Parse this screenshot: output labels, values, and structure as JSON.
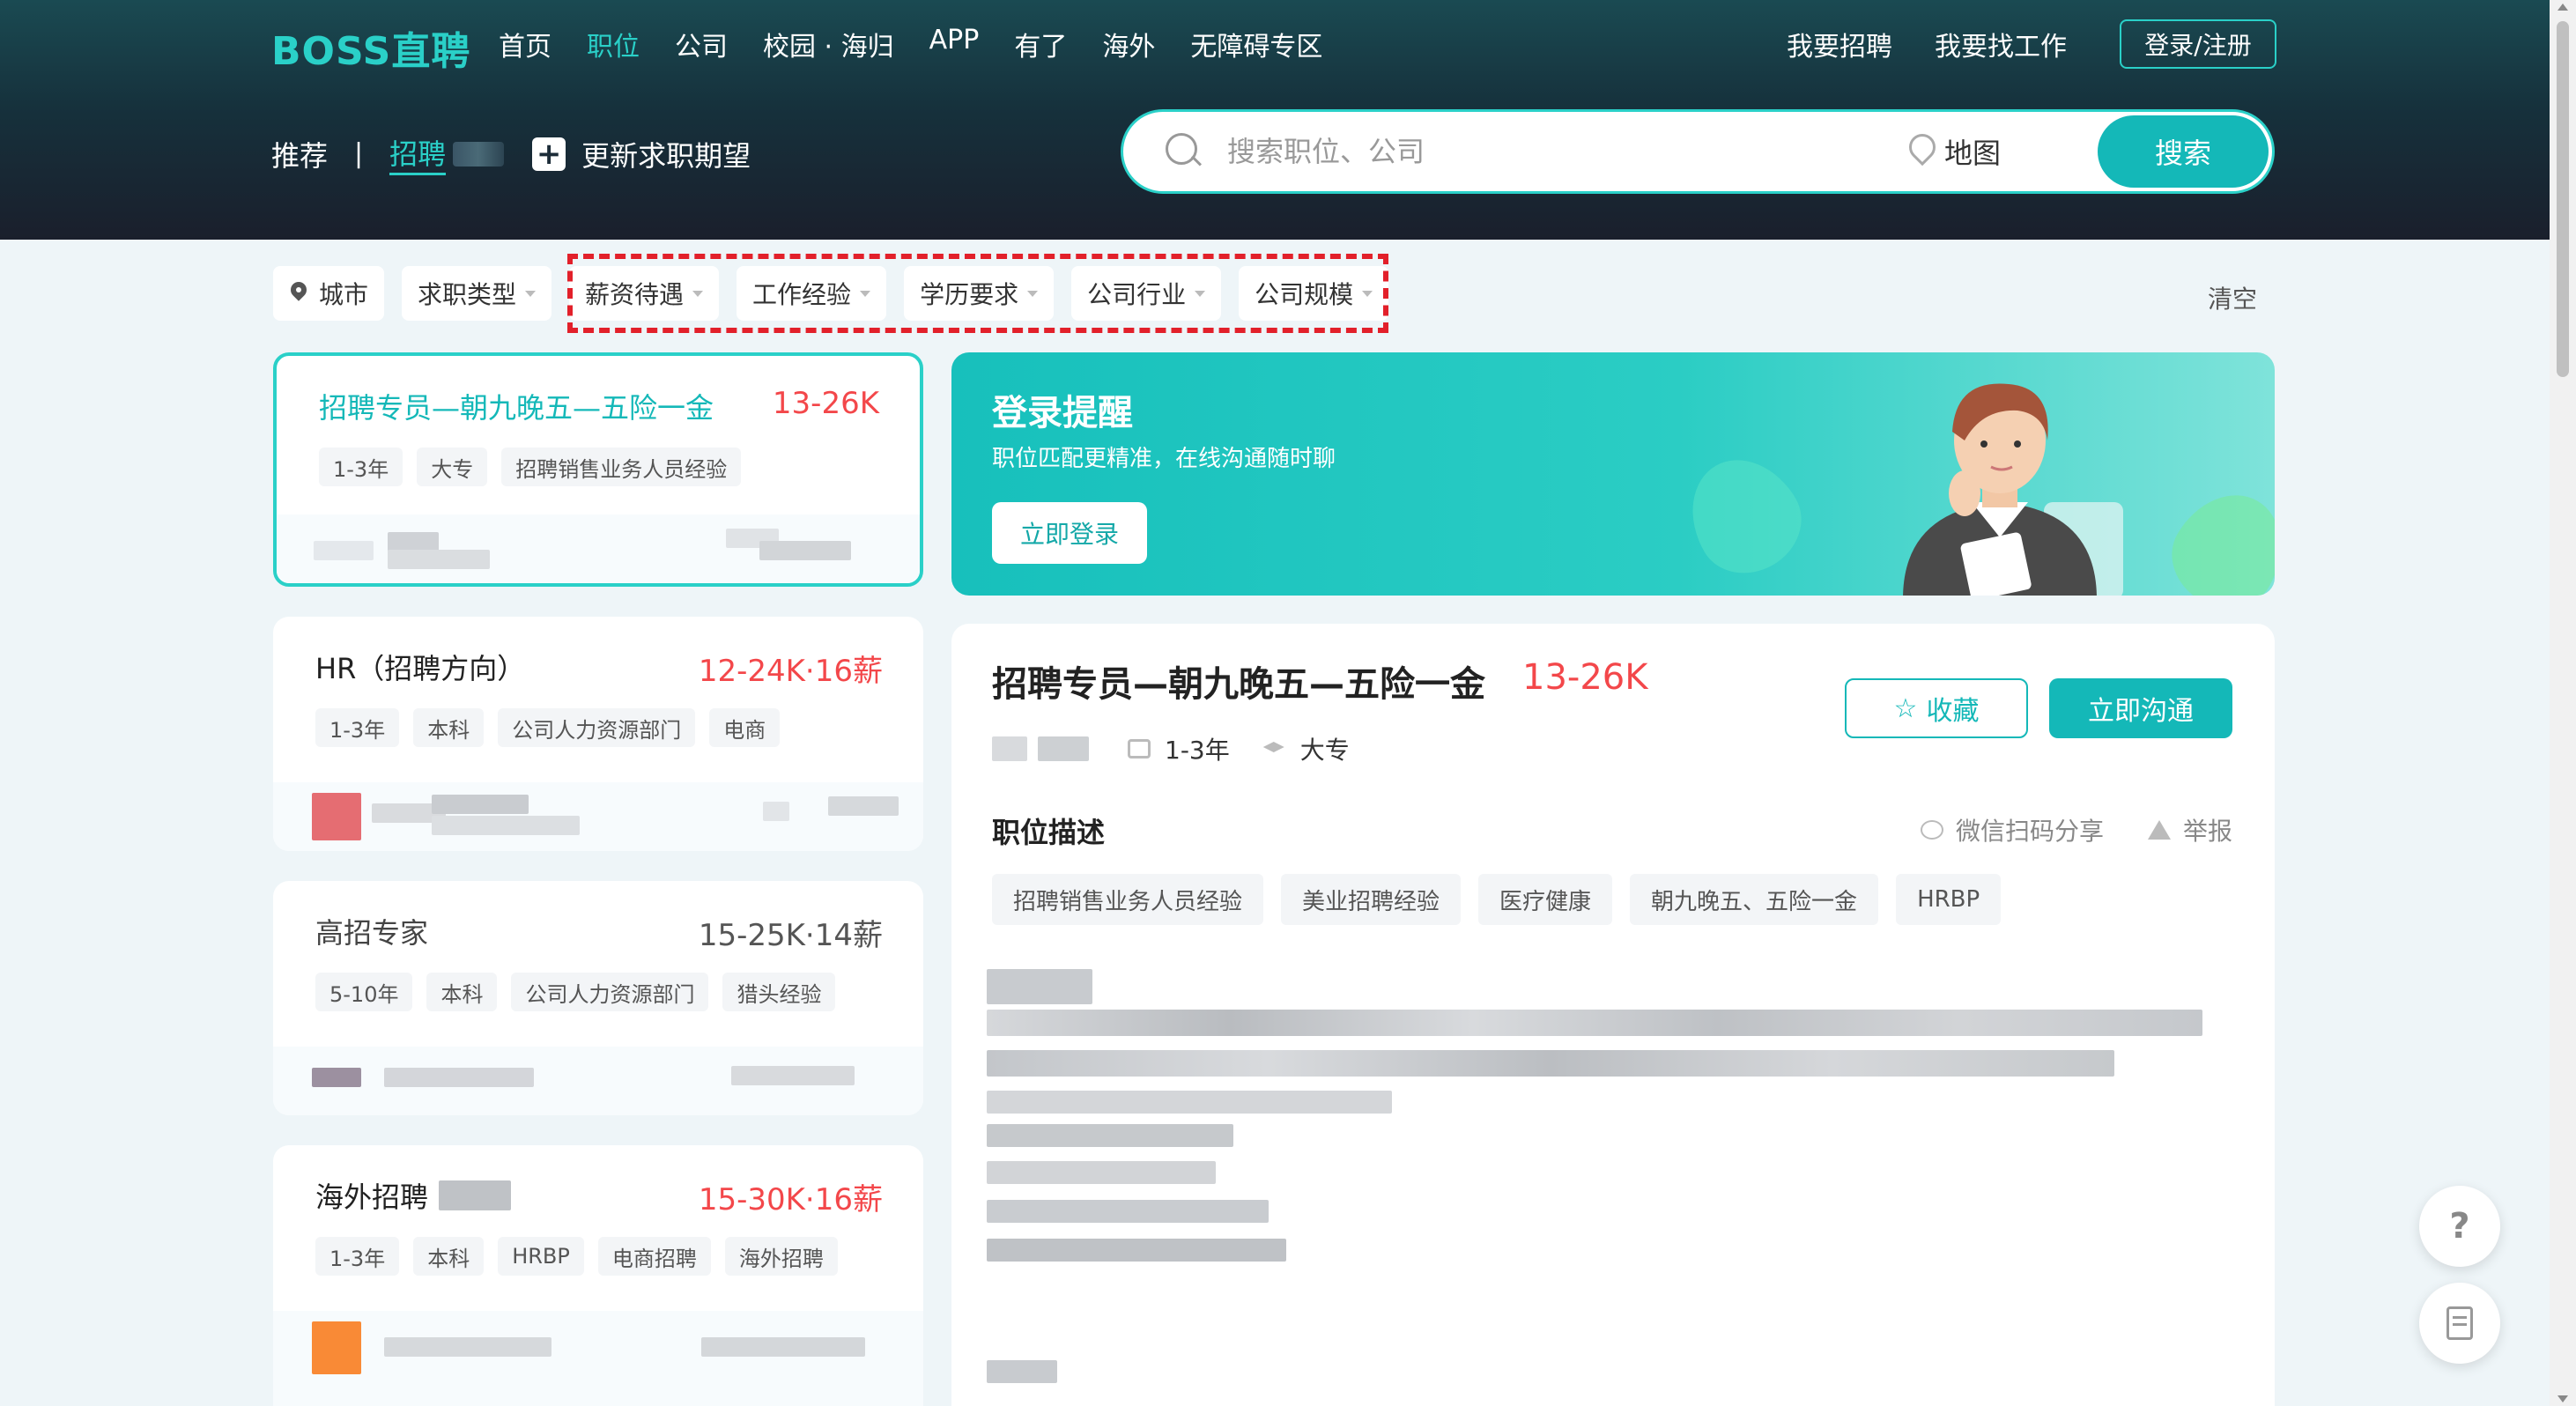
{
  "header": {
    "logo": "BOSS直聘",
    "nav": [
      "首页",
      "职位",
      "公司",
      "校园 · 海归",
      "APP",
      "有了",
      "海外",
      "无障碍专区"
    ],
    "active_nav": "职位",
    "right_links": [
      "我要招聘",
      "我要找工作"
    ],
    "login_label": "登录/注册"
  },
  "subnav": {
    "recommend": "推荐",
    "separator": "|",
    "hiring": "招聘",
    "update_label": "更新求职期望"
  },
  "search": {
    "placeholder": "搜索职位、公司",
    "map_label": "地图",
    "button_label": "搜索"
  },
  "filters": {
    "items": [
      "城市",
      "求职类型",
      "薪资待遇",
      "工作经验",
      "学历要求",
      "公司行业",
      "公司规模"
    ],
    "clear_label": "清空"
  },
  "jobs": [
    {
      "title": "招聘专员—朝九晚五—五险一金",
      "salary": "13-26K",
      "tags": [
        "1-3年",
        "大专",
        "招聘销售业务人员经验"
      ],
      "active": true
    },
    {
      "title": "HR（招聘方向）",
      "salary": "12-24K·16薪",
      "tags": [
        "1-3年",
        "本科",
        "公司人力资源部门",
        "电商"
      ]
    },
    {
      "title": "高招专家",
      "salary": "15-25K·14薪",
      "tags": [
        "5-10年",
        "本科",
        "公司人力资源部门",
        "猎头经验"
      ]
    },
    {
      "title": "海外招聘",
      "salary": "15-30K·16薪",
      "tags": [
        "1-3年",
        "本科",
        "HRBP",
        "电商招聘",
        "海外招聘"
      ]
    }
  ],
  "banner": {
    "title": "登录提醒",
    "subtitle": "职位匹配更精准，在线沟通随时聊",
    "button_label": "立即登录"
  },
  "detail": {
    "title": "招聘专员—朝九晚五—五险一金",
    "salary": "13-26K",
    "experience": "1-3年",
    "education": "大专",
    "fav_label": "收藏",
    "chat_label": "立即沟通",
    "section_title": "职位描述",
    "share_label": "微信扫码分享",
    "report_label": "举报",
    "tags": [
      "招聘销售业务人员经验",
      "美业招聘经验",
      "医疗健康",
      "朝九晚五、五险一金",
      "HRBP"
    ]
  },
  "float": {
    "help_label": "?"
  },
  "colors": {
    "accent": "#14b8b8",
    "salary": "#f3474a",
    "highlight_box": "#e2202a"
  }
}
